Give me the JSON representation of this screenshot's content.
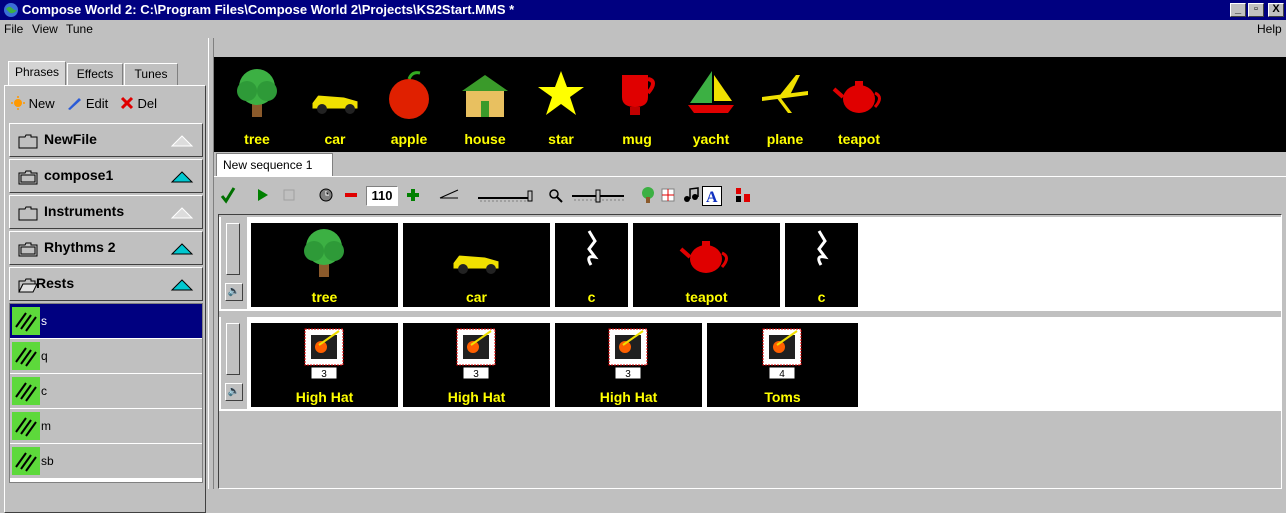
{
  "window": {
    "title": "Compose World 2: C:\\Program Files\\Compose World 2\\Projects\\KS2Start.MMS *",
    "min_label": "_",
    "max_label": "▫",
    "close_label": "X"
  },
  "menu": {
    "file": "File",
    "view": "View",
    "tune": "Tune",
    "help": "Help"
  },
  "left_tabs": [
    "Phrases",
    "Effects",
    "Tunes"
  ],
  "phrase_tools": {
    "new": "New",
    "edit": "Edit",
    "del": "Del"
  },
  "folders": [
    {
      "label": "NewFile",
      "expanded": false,
      "accent": "#ffffff"
    },
    {
      "label": "compose1",
      "expanded": true,
      "accent": "#00c0c0"
    },
    {
      "label": "Instruments",
      "expanded": false,
      "accent": "#ffffff"
    },
    {
      "label": "Rhythms 2",
      "expanded": true,
      "accent": "#00c0c0"
    },
    {
      "label": "Rests",
      "expanded": true,
      "accent": "#00c0c0"
    }
  ],
  "rests": [
    "s",
    "q",
    "c",
    "m",
    "sb"
  ],
  "palette": [
    "tree",
    "car",
    "apple",
    "house",
    "star",
    "mug",
    "yacht",
    "plane",
    "teapot"
  ],
  "sequence_tab": "New sequence 1",
  "toolbar": {
    "tempo": "110"
  },
  "tracks": [
    {
      "blocks": [
        {
          "label": "tree",
          "icon": "tree-icon"
        },
        {
          "label": "car",
          "icon": "car-icon"
        },
        {
          "label": "c",
          "icon": "rest-icon"
        },
        {
          "label": "teapot",
          "icon": "teapot-icon"
        },
        {
          "label": "c",
          "icon": "rest-icon"
        }
      ]
    },
    {
      "blocks": [
        {
          "label": "High Hat",
          "icon": "drum-icon",
          "num": "3"
        },
        {
          "label": "High Hat",
          "icon": "drum-icon",
          "num": "3"
        },
        {
          "label": "High Hat",
          "icon": "drum-icon",
          "num": "3"
        },
        {
          "label": "Toms",
          "icon": "drum-icon",
          "num": "4"
        }
      ]
    }
  ],
  "colors": {
    "titlebar": "#000080",
    "label_yellow": "#ffff00",
    "selection": "#000080"
  }
}
